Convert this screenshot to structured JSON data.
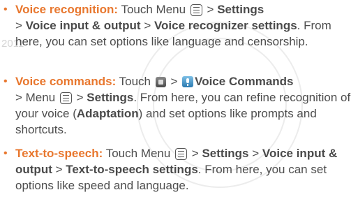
{
  "watermark_text": "2011",
  "items": [
    {
      "term": "Voice recognition:",
      "t1": " Touch Menu ",
      "t2": " > ",
      "b1": "Settings",
      "t3": " > ",
      "b2": "Voice input & output",
      "t4": " > ",
      "b3": "Voice recognizer settings",
      "t5": ". From here, you can set options like language and censorship."
    },
    {
      "term": "Voice commands:",
      "t1": " Touch ",
      "t2": " > ",
      "b1": "Voice Commands",
      "t3": " > Menu ",
      "t4": " > ",
      "b2": "Settings",
      "t5": ". From here, you can refine recognition of your voice (",
      "b3": "Adaptation",
      "t6": ") and set options like prompts and shortcuts."
    },
    {
      "term": "Text-to-speech:",
      "t1": " Touch Menu ",
      "t2": " > ",
      "b1": "Settings",
      "t3": " > ",
      "b2": "Voice input & output",
      "t4": " > ",
      "b3": "Text-to-speech settings",
      "t5": ". From here, you can set options like speed and language."
    }
  ]
}
